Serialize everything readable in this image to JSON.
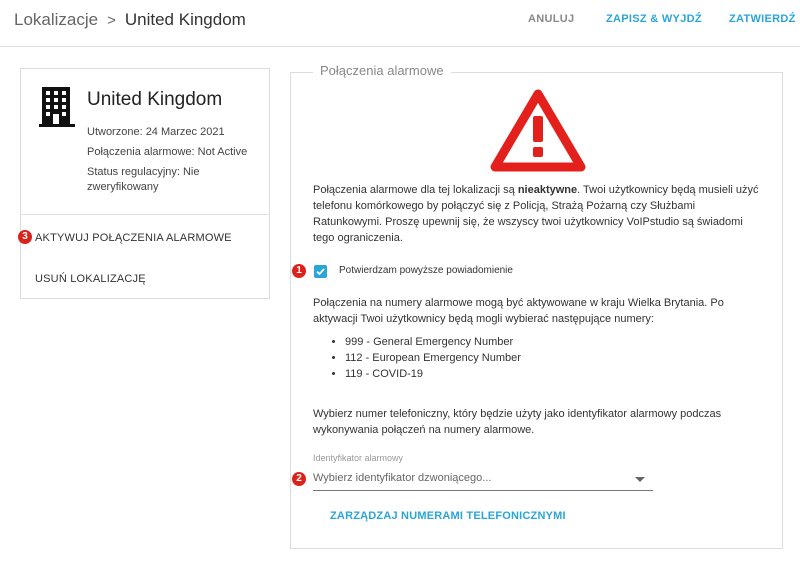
{
  "header": {
    "parent": "Lokalizacje",
    "separator": ">",
    "current": "United Kingdom",
    "cancel": "ANULUJ",
    "save_exit": "ZAPISZ & WYJDŹ",
    "confirm": "ZATWIERDŹ"
  },
  "location": {
    "icon": "building-icon",
    "name": "United Kingdom",
    "created": "Utworzone: 24 Marzec 2021",
    "emergency_status": "Połączenia alarmowe: Not Active",
    "regulatory_status": "Status regulacyjny: Nie zweryfikowany",
    "activate": "AKTYWUJ POŁĄCZENIA ALARMOWE",
    "delete": "USUŃ LOKALIZACJĘ"
  },
  "panel": {
    "title": "Połączenia alarmowe",
    "warning_icon": "warning-triangle-icon",
    "warning_pre": "Połączenia alarmowe dla tej lokalizacji są ",
    "warning_bold": "nieaktywne",
    "warning_post": ". Twoi użytkownicy będą musieli użyć telefonu komórkowego by połączyć się z Policją, Strażą Pożarną czy Służbami Ratunkowymi. Proszę upewnij się, że wszyscy twoi użytkownicy VoIPstudio są świadomi tego ograniczenia.",
    "confirm_label": "Potwierdzam powyższe powiadomienie",
    "confirm_checked": true,
    "activation_info": "Połączenia na numery alarmowe mogą być aktywowane w kraju Wielka Brytania. Po aktywacji Twoi użytkownicy będą mogli wybierać następujące numery:",
    "numbers": [
      "999 - General Emergency Number",
      "112 - European Emergency Number",
      "119 - COVID-19"
    ],
    "choose_info": "Wybierz numer telefoniczny, który będzie użyty jako identyfikator alarmowy podczas wykonywania połączeń na numery alarmowe.",
    "field_label": "Identyfikator alarmowy",
    "field_placeholder": "Wybierz identyfikator dzwoniącego...",
    "manage_numbers": "ZARZĄDZAJ NUMERAMI TELEFONICZNYMI"
  },
  "badges": {
    "one": "1",
    "two": "2",
    "three": "3"
  },
  "colors": {
    "accent": "#2aa5d8",
    "warning": "#e3201b",
    "badge": "#d9231b"
  }
}
